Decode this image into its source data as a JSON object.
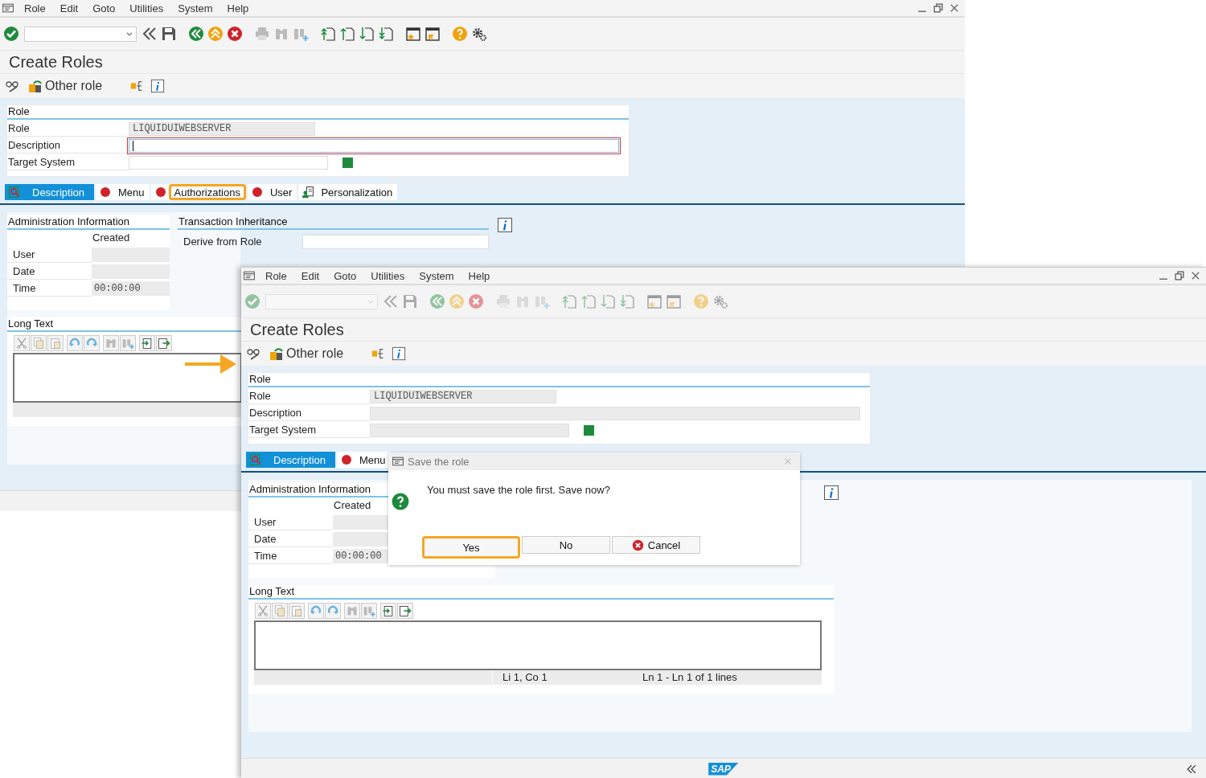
{
  "windows": [
    {
      "menu": [
        "Role",
        "Edit",
        "Goto",
        "Utilities",
        "System",
        "Help"
      ],
      "inactive": false,
      "title": "Create Roles",
      "app_toolbar": {
        "button": "Other role"
      },
      "role_group": {
        "heading": "Role",
        "fields": [
          {
            "label": "Role",
            "kind": "readonly",
            "value": "LIQUIDUIWEBSERVER"
          },
          {
            "label": "Description",
            "kind": "focused"
          },
          {
            "label": "Target System",
            "kind": "input"
          }
        ]
      },
      "tabs": [
        {
          "label": "Description",
          "kind": "overview",
          "selected": true,
          "highlighted": false
        },
        {
          "label": "Menu",
          "kind": "incomplete",
          "selected": false,
          "highlighted": false
        },
        {
          "label": "Authorizations",
          "kind": "incomplete",
          "selected": false,
          "highlighted": true
        },
        {
          "label": "User",
          "kind": "incomplete",
          "selected": false,
          "highlighted": false
        },
        {
          "label": "Personalization",
          "kind": "personal",
          "selected": false,
          "highlighted": false
        }
      ],
      "admin": {
        "heading": "Administration Information",
        "column": "Created",
        "rows": [
          {
            "label": "User"
          },
          {
            "label": "Date"
          },
          {
            "label": "Time",
            "value": "00:00:00"
          }
        ]
      },
      "inheritance": {
        "heading": "Transaction Inheritance",
        "label": "Derive from Role"
      },
      "long_text": {
        "heading": "Long Text"
      }
    },
    {
      "menu": [
        "Role",
        "Edit",
        "Goto",
        "Utilities",
        "System",
        "Help"
      ],
      "inactive": true,
      "title": "Create Roles",
      "app_toolbar": {
        "button": "Other role"
      },
      "role_group": {
        "heading": "Role",
        "fields": [
          {
            "label": "Role",
            "kind": "readonly",
            "value": "LIQUIDUIWEBSERVER"
          },
          {
            "label": "Description",
            "kind": "readonly"
          },
          {
            "label": "Target System",
            "kind": "readonly"
          }
        ]
      },
      "tabs": [
        {
          "label": "Description",
          "kind": "overview",
          "selected": true,
          "highlighted": false
        },
        {
          "label": "Menu",
          "kind": "incomplete",
          "selected": false,
          "highlighted": false
        }
      ],
      "admin": {
        "heading": "Administration Information",
        "column": "Created",
        "rows": [
          {
            "label": "User"
          },
          {
            "label": "Date"
          },
          {
            "label": "Time",
            "value": "00:00:00"
          }
        ]
      },
      "long_text": {
        "heading": "Long Text",
        "status": [
          "Li 1, Co 1",
          "Ln 1 - Ln 1 of 1 lines"
        ]
      },
      "footer": {
        "logo": "SAP"
      },
      "dialog": {
        "title": "Save the role",
        "message": "You must save the role first. Save now?",
        "buttons": [
          {
            "label": "Yes",
            "kind": "plain",
            "highlighted": true
          },
          {
            "label": "No",
            "kind": "plain",
            "highlighted": false
          },
          {
            "label": "Cancel",
            "kind": "cancel",
            "highlighted": false
          }
        ]
      }
    }
  ]
}
